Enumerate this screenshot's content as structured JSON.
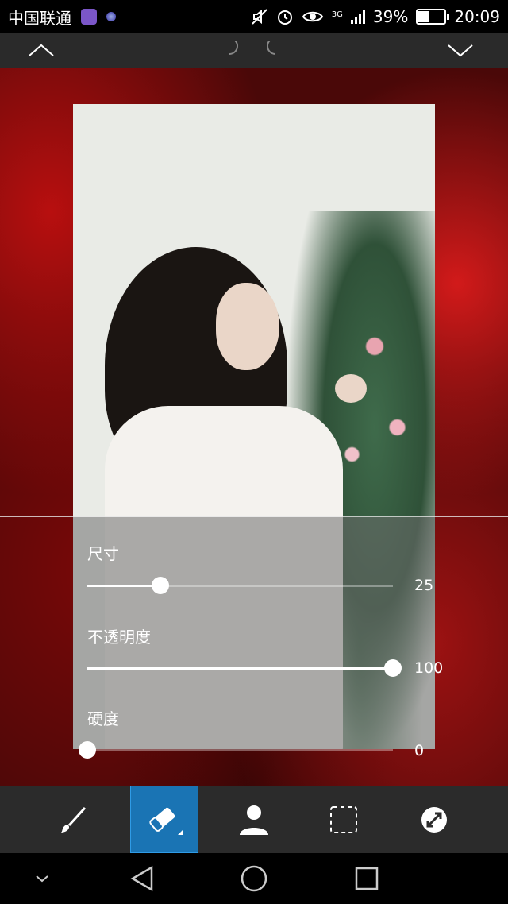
{
  "status_bar": {
    "carrier": "中国联通",
    "network": "3G",
    "battery": "39%",
    "battery_level": 0.39,
    "time": "20:09",
    "icons": [
      "gallery-app-icon",
      "browser-app-icon",
      "mute-icon",
      "alarm-icon",
      "eye-comfort-icon",
      "signal-icon",
      "battery-icon"
    ]
  },
  "top_toolbar": {
    "icons": [
      "chevron-up-icon",
      "undo-icon",
      "redo-icon",
      "chevron-down-icon"
    ]
  },
  "brush_settings": {
    "sliders": [
      {
        "label": "尺寸",
        "value": "25",
        "fraction": 0.24
      },
      {
        "label": "不透明度",
        "value": "100",
        "fraction": 1.0
      },
      {
        "label": "硬度",
        "value": "0",
        "fraction": 0.0
      }
    ]
  },
  "bottom_tools": {
    "selected": "eraser",
    "items": [
      "brush-icon",
      "eraser-icon",
      "person-icon",
      "selection-icon",
      "blend-icon"
    ]
  },
  "nav_bar": {
    "icons": [
      "collapse-icon",
      "back-icon",
      "home-icon",
      "recents-icon"
    ]
  },
  "colors": {
    "accent": "#1a74b4",
    "toolbar_bg": "#2b2b2b",
    "background_red": "#b80f0f"
  }
}
